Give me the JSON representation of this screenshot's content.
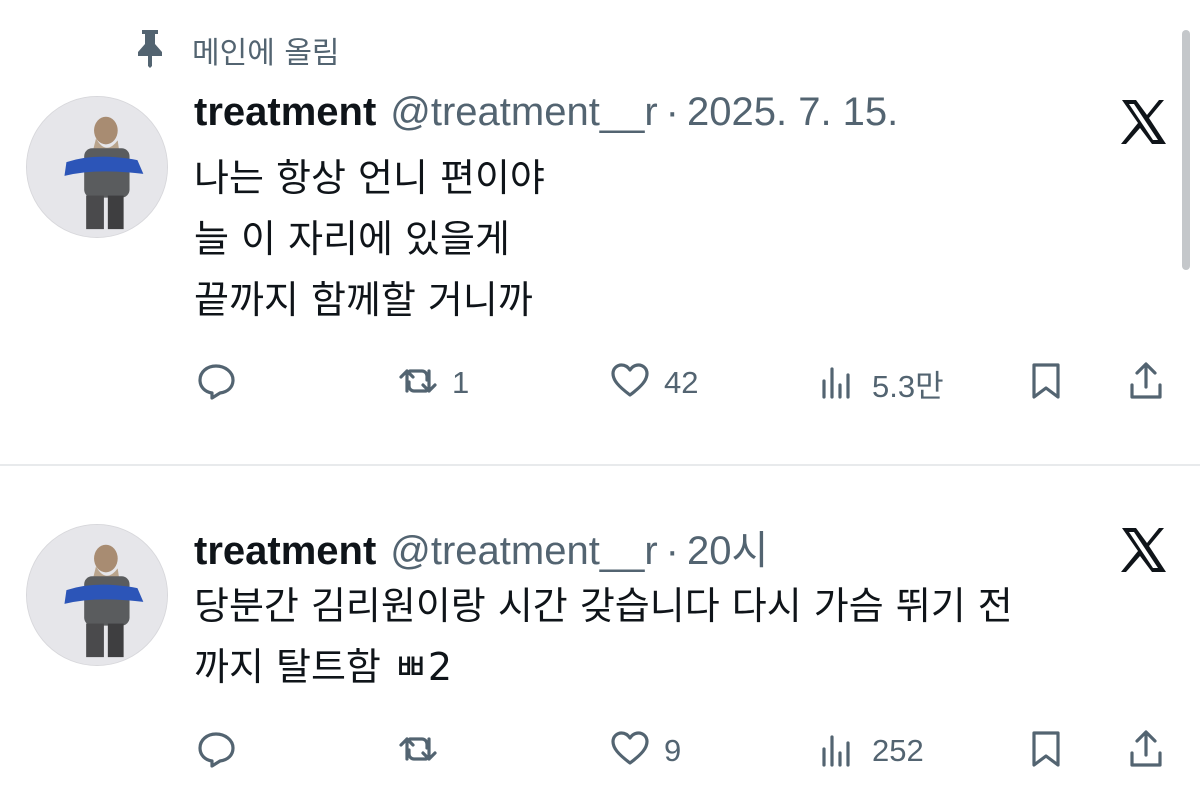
{
  "pinned": {
    "label": "메인에 올림",
    "icon": "pin-icon"
  },
  "tweets": [
    {
      "name": "treatment",
      "handle": "@treatment__r",
      "separator": "·",
      "time": "2025. 7. 15.",
      "lines": [
        "나는 항상 언니 편이야",
        "늘 이 자리에 있을게",
        "끝까지 함께할 거니까"
      ],
      "retweets": "1",
      "likes": "42",
      "views": "5.3만"
    },
    {
      "name": "treatment",
      "handle": "@treatment__r",
      "separator": "·",
      "time": "20시",
      "lines": [
        "당분간 김리원이랑 시간 갖습니다 다시 가슴 뛰기 전",
        "까지 탈트함 ㅃ2"
      ],
      "retweets": "",
      "likes": "9",
      "views": "252"
    }
  ],
  "colors": {
    "text": "#0f1419",
    "secondary": "#536471",
    "divider": "#e8eaec"
  }
}
